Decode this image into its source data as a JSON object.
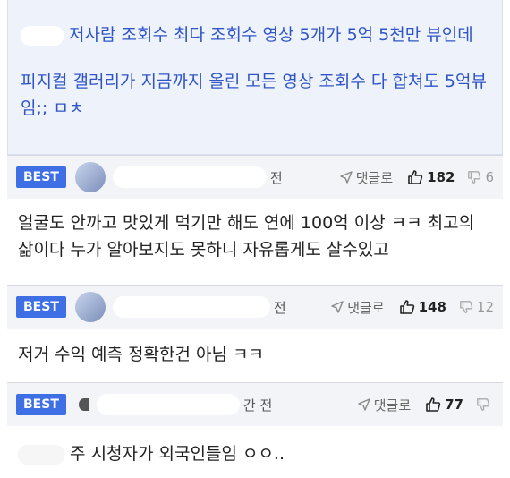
{
  "quote": {
    "line1": "저사람 조회수 최다 조회수 영상 5개가 5억 5천만 뷰인데",
    "line2": "피지컬 갤러리가 지금까지 올린 모든 영상 조회수 다 합쳐도 5억뷰임;; ㅁㅊ"
  },
  "comments": [
    {
      "badge": "BEST",
      "time": "전",
      "reply_label": "댓글로",
      "likes": "182",
      "dislikes": "6",
      "text": "얼굴도 안까고 맛있게 먹기만 해도 연에 100억 이상 ㅋㅋ 최고의 삶이다 누가 알아보지도 못하니 자유롭게도 살수있고"
    },
    {
      "badge": "BEST",
      "time": "전",
      "reply_label": "댓글로",
      "likes": "148",
      "dislikes": "12",
      "text": "저거 수익 예측 정확한건 아님 ㅋㅋ"
    },
    {
      "badge": "BEST",
      "time": "간 전",
      "reply_label": "댓글로",
      "likes": "77",
      "dislikes": "",
      "text": "주 시청자가 외국인들임 ㅇㅇ.."
    }
  ],
  "colors": {
    "accent": "#3f6fe4",
    "quote_text": "#2f55c7",
    "quote_bg": "#eef2fb",
    "meta_bg": "#f3f4f7"
  },
  "icons": {
    "reply": "send-arrow-icon",
    "like": "thumbs-up-icon",
    "dislike": "thumbs-down-icon"
  }
}
